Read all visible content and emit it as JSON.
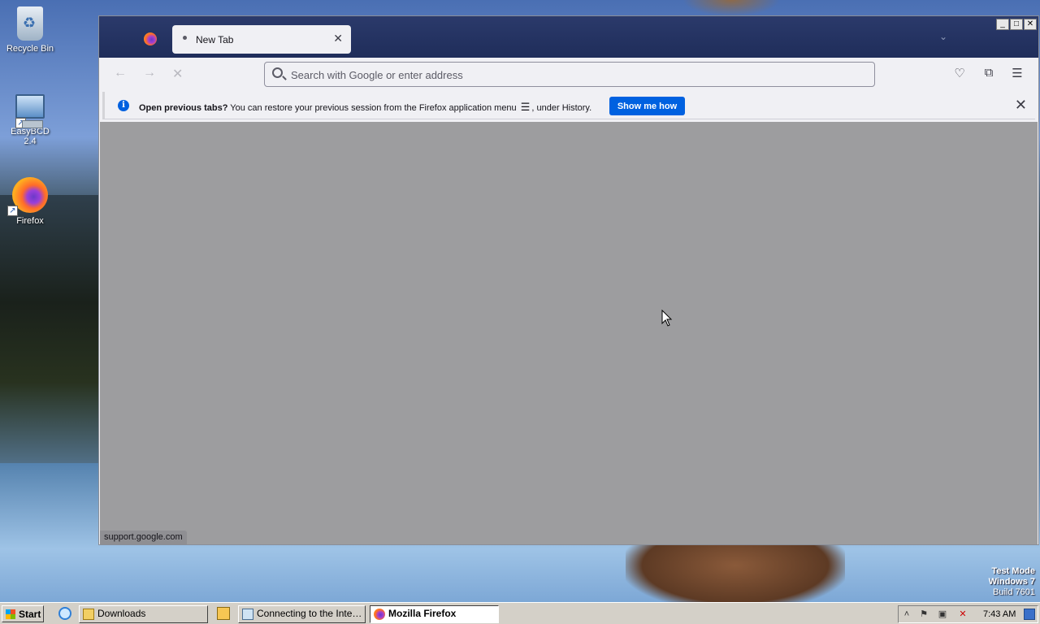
{
  "desktop": {
    "icons": [
      {
        "label": "Recycle Bin",
        "icon": "recycle-bin-icon"
      },
      {
        "label": "EasyBCD 2.4",
        "icon": "easybcd-icon"
      },
      {
        "label": "Firefox",
        "icon": "firefox-icon"
      }
    ],
    "watermark": {
      "line1": "Test Mode",
      "line2": "Windows 7",
      "line3": "Build 7601"
    }
  },
  "browser": {
    "tab": {
      "title": "New Tab",
      "close_glyph": "✕"
    },
    "tab_list_glyph": "⌄",
    "window_controls": {
      "minimize": "_",
      "maximize": "□",
      "close": "✕"
    },
    "nav": {
      "back": "←",
      "forward": "→",
      "stop": "✕"
    },
    "urlbar": {
      "placeholder": "Search with Google or enter address",
      "value": ""
    },
    "toolbar": {
      "pocket": "♡",
      "extensions": "⧉",
      "menu": "☰"
    },
    "notification": {
      "bold_text": "Open previous tabs?",
      "text_before_menu": "You can restore your previous session from the Firefox application menu",
      "menu_glyph": "☰",
      "text_after_menu": ", under History.",
      "button_label": "Show me how",
      "close_glyph": "✕"
    },
    "status_url": "support.google.com"
  },
  "taskbar": {
    "start_label": "Start",
    "buttons": [
      {
        "label": "Downloads",
        "active": false
      },
      {
        "label": "Connecting to the Intern...",
        "active": false
      },
      {
        "label": "Mozilla Firefox",
        "active": true
      }
    ],
    "tray": {
      "expand": "˄",
      "flag": "⚑",
      "network": "▣",
      "volume": "✕",
      "clock": "7:43 AM"
    }
  },
  "colors": {
    "titlebar": "#1f2d5a",
    "accent_button": "#0061e0",
    "content_overlay": "#9d9d9f",
    "taskbar": "#d4d0c8"
  }
}
